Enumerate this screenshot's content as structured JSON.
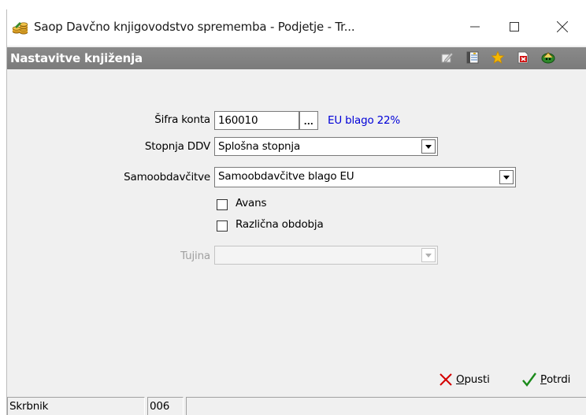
{
  "window": {
    "title": "Saop Davčno knjigovodstvo sprememba - Podjetje - Tr...",
    "app_icon": "coins-icon",
    "controls": {
      "minimize": "minimize-icon",
      "maximize": "maximize-icon",
      "close": "close-icon"
    }
  },
  "header": {
    "title": "Nastavitve knjiženja",
    "toolbar": [
      "edit-icon",
      "list-icon",
      "star-icon",
      "delete-icon",
      "exit-icon"
    ]
  },
  "form": {
    "sifra_konta": {
      "label": "Šifra konta",
      "value": "160010",
      "button": "...",
      "description": "EU blago 22%"
    },
    "stopnja_ddv": {
      "label": "Stopnja DDV",
      "value": "Splošna stopnja"
    },
    "samoobdavcitve": {
      "label": "Samoobdavčitve",
      "value": "Samoobdavčitve blago EU"
    },
    "avans": {
      "label": "Avans",
      "checked": false
    },
    "razlicna_obdobja": {
      "label": "Različna obdobja",
      "checked": false
    },
    "tujina": {
      "label": "Tujina",
      "value": "",
      "enabled": false
    }
  },
  "buttons": {
    "cancel": {
      "mnemonic": "O",
      "rest": "pusti"
    },
    "confirm": {
      "mnemonic": "P",
      "rest": "otrdi"
    }
  },
  "status_bar": {
    "user": "Skrbnik",
    "code": "006",
    "extra": ""
  },
  "colors": {
    "header_bg": "#858585",
    "link": "#0000d8",
    "cancel_icon": "#d40000",
    "confirm_icon": "#1a8a1a",
    "star": "#f5b800"
  }
}
